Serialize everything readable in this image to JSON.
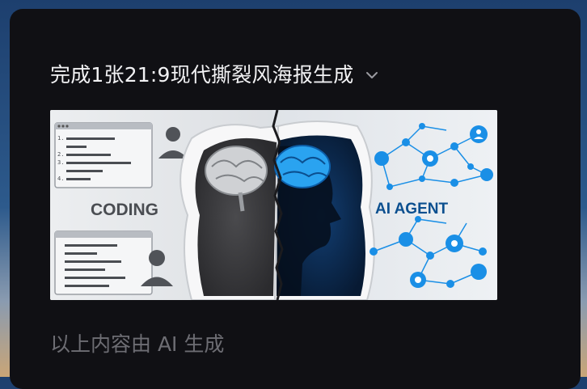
{
  "header": {
    "title": "完成1张21:9现代撕裂风海报生成",
    "chevron_icon": "chevron-down-icon"
  },
  "poster": {
    "left_label": "CODING",
    "right_label": "AI AGENT",
    "code_lines": [
      "1.",
      "2.",
      "3.",
      "4."
    ],
    "colors": {
      "accent": "#1a8fe6",
      "dark_blue": "#0b2a52",
      "paper": "#e9eaec"
    }
  },
  "footer": {
    "note": "以上内容由 AI 生成"
  }
}
